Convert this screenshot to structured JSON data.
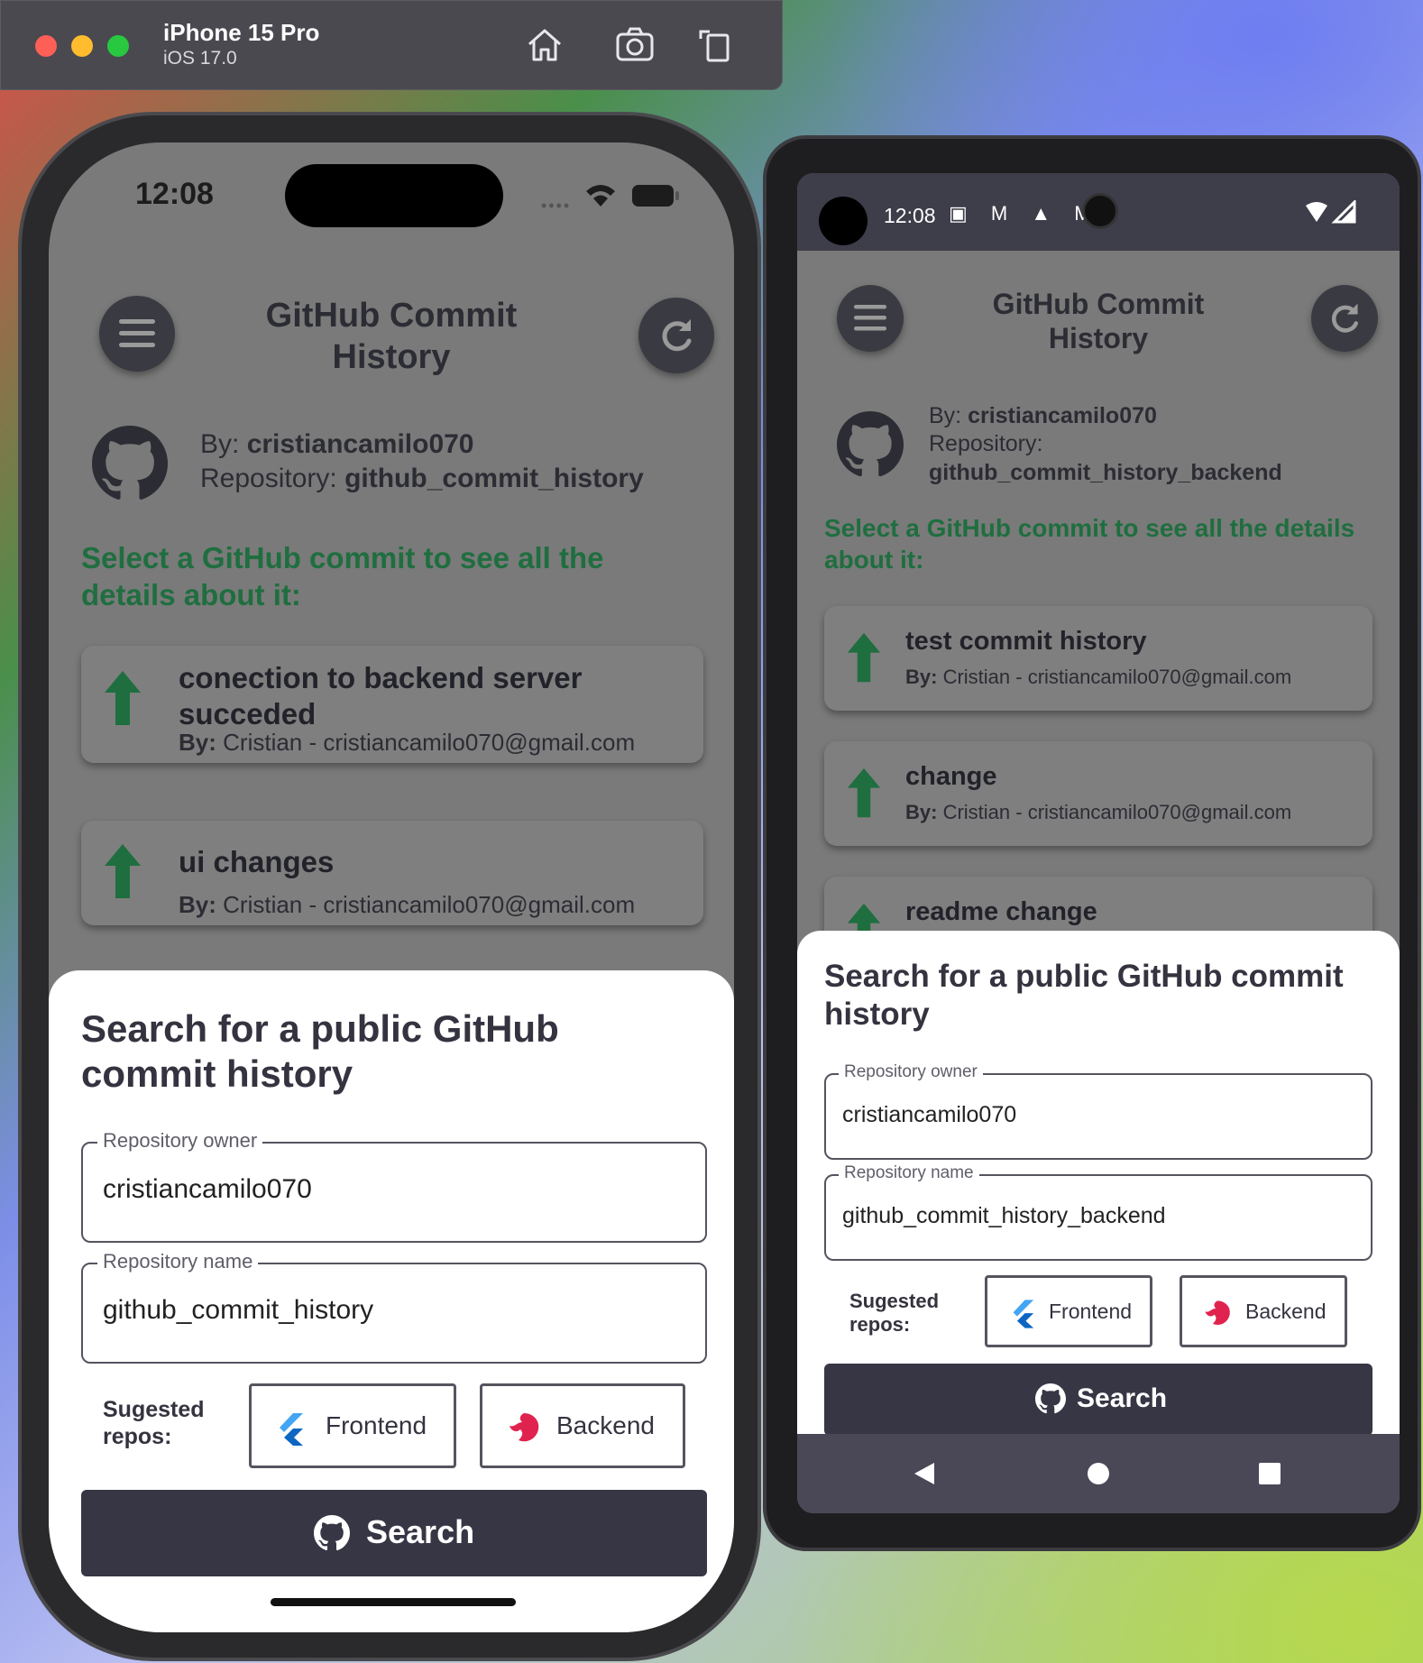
{
  "simulator": {
    "device_name": "iPhone 15 Pro",
    "os_version": "iOS 17.0"
  },
  "ios": {
    "status_time": "12:08",
    "app_title": "GitHub Commit History",
    "repo_owner_prefix": "By: ",
    "repo_owner": "cristiancamilo070",
    "repo_name_prefix": "Repository: ",
    "repo_name": "github_commit_history",
    "select_prompt": "Select a GitHub commit to see all the details about it:",
    "commits": [
      {
        "message": "conection to backend server succeded",
        "author_prefix": "By:",
        "author": " Cristian - cristiancamilo070@gmail.com"
      },
      {
        "message": "ui changes",
        "author_prefix": "By:",
        "author": " Cristian - cristiancamilo070@gmail.com"
      }
    ],
    "sheet": {
      "title": "Search for a public GitHub commit history",
      "owner_label": "Repository owner",
      "owner_value": "cristiancamilo070",
      "name_label": "Repository name",
      "name_value": "github_commit_history",
      "suggested_label": "Sugested repos:",
      "frontend_label": "Frontend",
      "backend_label": "Backend",
      "search_label": "Search"
    }
  },
  "android": {
    "status_time": "12:08",
    "app_title": "GitHub Commit History",
    "repo_owner_prefix": "By: ",
    "repo_owner": "cristiancamilo070",
    "repo_name_prefix": "Repository:",
    "repo_name": "github_commit_history_backend",
    "select_prompt": "Select a GitHub commit to see all the details about it:",
    "commits": [
      {
        "message": "test commit history",
        "author_prefix": "By:",
        "author": " Cristian - cristiancamilo070@gmail.com"
      },
      {
        "message": "change",
        "author_prefix": "By:",
        "author": " Cristian - cristiancamilo070@gmail.com"
      },
      {
        "message": "readme change"
      }
    ],
    "sheet": {
      "title": "Search for a public GitHub commit history",
      "owner_label": "Repository owner",
      "owner_value": "cristiancamilo070",
      "name_label": "Repository name",
      "name_value": "github_commit_history_backend",
      "suggested_label": "Sugested repos:",
      "frontend_label": "Frontend",
      "backend_label": "Backend",
      "search_label": "Search"
    }
  },
  "colors": {
    "accent_green": "#1f6e3f",
    "button_dark": "#373645",
    "nest_red": "#e0234e",
    "flutter_blue": "#42a5f5"
  }
}
